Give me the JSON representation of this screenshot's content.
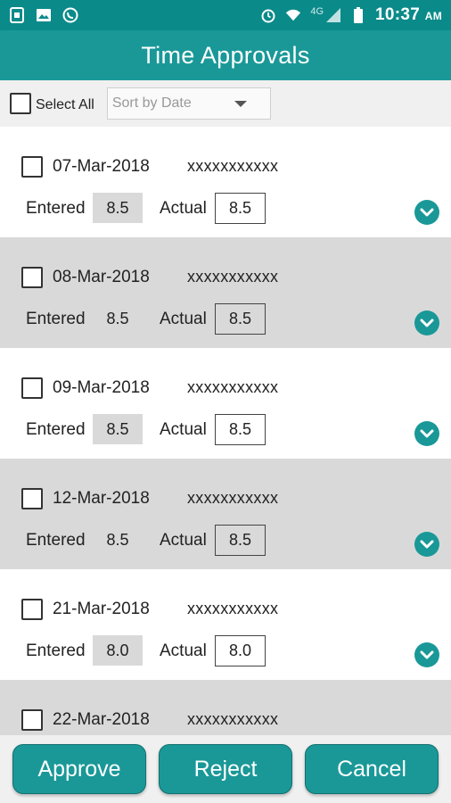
{
  "status_bar": {
    "time": "10:37",
    "ampm": "AM",
    "network": "4G",
    "left_icons": [
      "sim-card-icon",
      "image-icon",
      "whatsapp-icon"
    ],
    "right_icons": [
      "alarm-icon",
      "wifi-icon",
      "signal-icon",
      "battery-icon"
    ]
  },
  "app_bar": {
    "title": "Time Approvals"
  },
  "filter": {
    "select_all_label": "Select All",
    "sort_value": "Sort by Date"
  },
  "records": [
    {
      "date": "07-Mar-2018",
      "name": "xxxxxxxxxxx",
      "entered_label": "Entered",
      "entered": "8.5",
      "actual_label": "Actual",
      "actual": "8.5"
    },
    {
      "date": "08-Mar-2018",
      "name": "xxxxxxxxxxx",
      "entered_label": "Entered",
      "entered": "8.5",
      "actual_label": "Actual",
      "actual": "8.5"
    },
    {
      "date": "09-Mar-2018",
      "name": "xxxxxxxxxxx",
      "entered_label": "Entered",
      "entered": "8.5",
      "actual_label": "Actual",
      "actual": "8.5"
    },
    {
      "date": "12-Mar-2018",
      "name": "xxxxxxxxxxx",
      "entered_label": "Entered",
      "entered": "8.5",
      "actual_label": "Actual",
      "actual": "8.5"
    },
    {
      "date": "21-Mar-2018",
      "name": "xxxxxxxxxxx",
      "entered_label": "Entered",
      "entered": "8.0",
      "actual_label": "Actual",
      "actual": "8.0"
    },
    {
      "date": "22-Mar-2018",
      "name": "xxxxxxxxxxx",
      "entered_label": "",
      "entered": "",
      "actual_label": "",
      "actual": ""
    }
  ],
  "actions": {
    "approve": "Approve",
    "reject": "Reject",
    "cancel": "Cancel"
  },
  "colors": {
    "status_bar": "#0b8a8a",
    "accent": "#1a9898",
    "row_shade": "#d9d9d9"
  }
}
